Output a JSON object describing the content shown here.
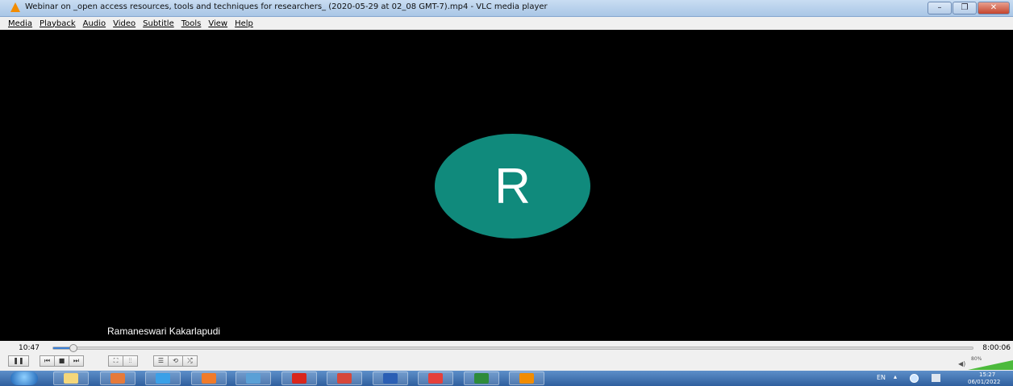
{
  "window": {
    "title": "Webinar on _open access resources, tools and techniques for researchers_ (2020-05-29 at 02_08 GMT-7).mp4 - VLC media player",
    "buttons": [
      "–",
      "❐",
      "✕"
    ]
  },
  "menu": {
    "items": [
      "Media",
      "Playback",
      "Audio",
      "Video",
      "Subtitle",
      "Tools",
      "View",
      "Help"
    ]
  },
  "video": {
    "avatar_letter": "R",
    "avatar_color": "#108a7c",
    "participant_name": "Ramaneswari Kakarlapudi"
  },
  "player": {
    "time_elapsed": "10:47",
    "time_total": "8:00:06",
    "progress": 0.022,
    "volume_label": "80%",
    "volume": 0.8,
    "buttons": {
      "play_pause": "❚❚",
      "prev": "⏮",
      "stop": "■",
      "next": "⏭",
      "fullscreen": "⛶",
      "ext_settings": "⫶⫶",
      "playlist": "☰",
      "loop": "⟲",
      "shuffle": "⤮"
    }
  },
  "taskbar": {
    "apps": [
      {
        "name": "explorer",
        "color": "#f5d77a"
      },
      {
        "name": "recorder",
        "color": "#e57a3a"
      },
      {
        "name": "internet-explorer",
        "color": "#3aa0e8"
      },
      {
        "name": "media",
        "color": "#f07b2a"
      },
      {
        "name": "screen-capture",
        "color": "#5aa0d6"
      },
      {
        "name": "acrobat",
        "color": "#d9261c"
      },
      {
        "name": "chrome",
        "color": "#d6473a"
      },
      {
        "name": "word",
        "color": "#2b5fb4"
      },
      {
        "name": "anydesk",
        "color": "#e5403b"
      },
      {
        "name": "excel",
        "color": "#2e8b3a"
      },
      {
        "name": "vlc",
        "color": "#f28c00"
      }
    ],
    "lang": "EN",
    "clock_time": "15:27",
    "clock_date": "06/01/2022"
  }
}
